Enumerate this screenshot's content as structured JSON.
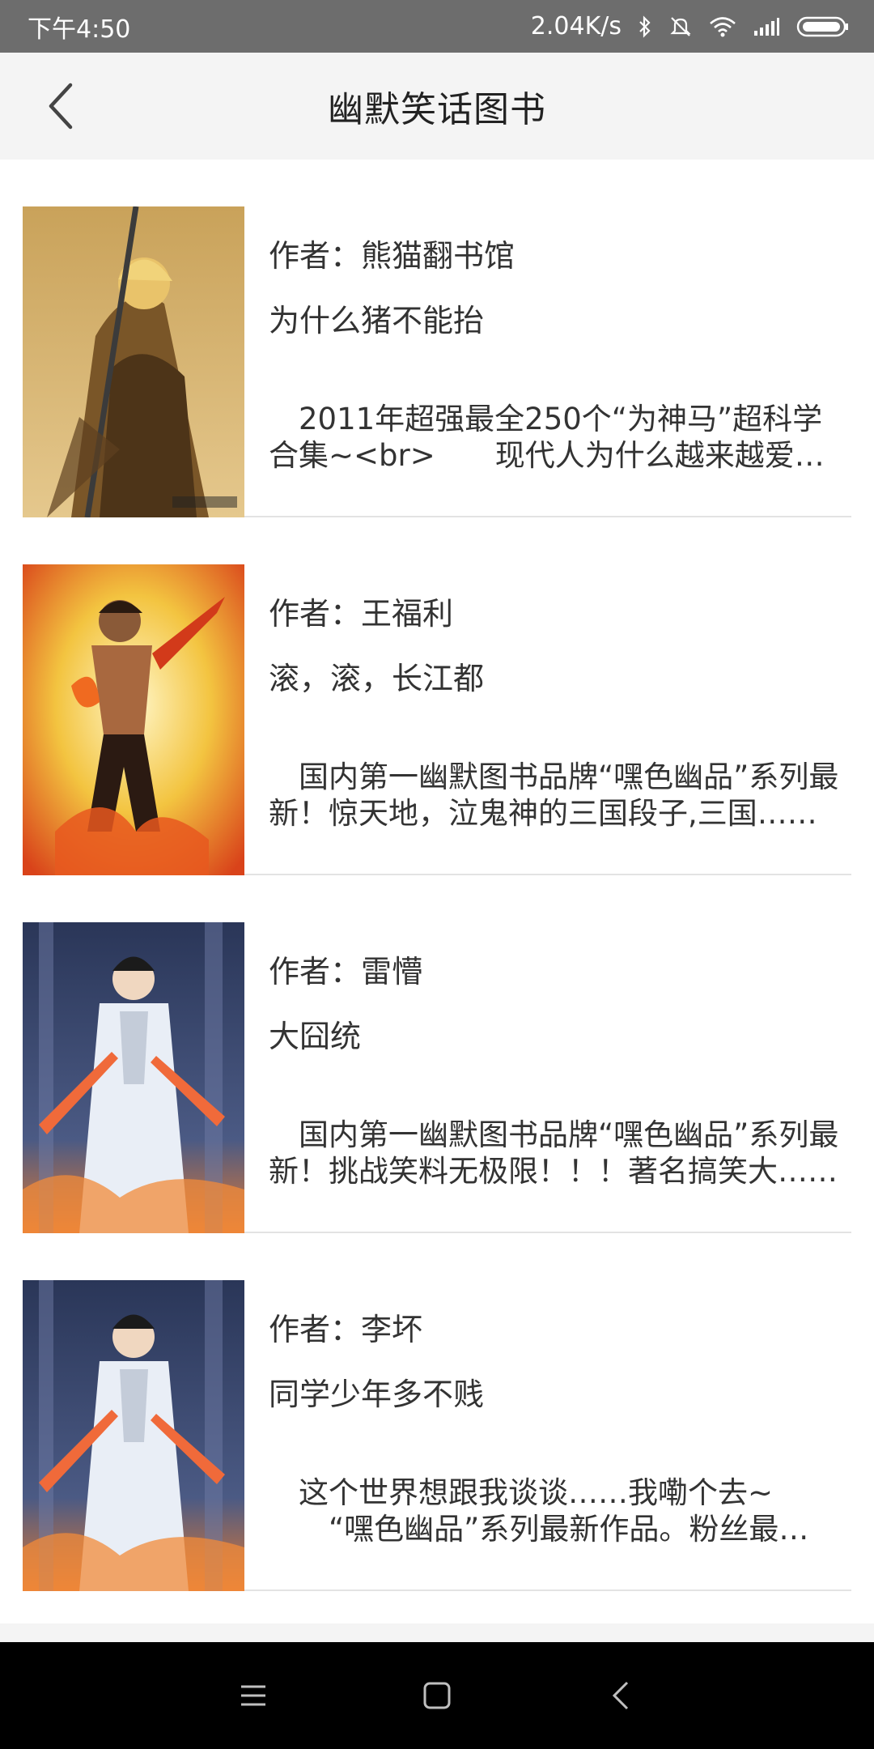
{
  "status_bar": {
    "time": "下午4:50",
    "net_speed": "2.04K/s",
    "icons": [
      "bluetooth-icon",
      "mute-icon",
      "wifi-icon",
      "signal-icon",
      "battery-icon"
    ]
  },
  "header": {
    "title": "幽默笑话图书",
    "back_icon": "chevron-left-icon"
  },
  "books": [
    {
      "author": "作者：熊猫翻书馆",
      "title": "为什么猪不能抬",
      "description": "　2011年超强最全250个“为神马”超科学合集~<br>　　现代人为什么越来越爱挖坑……",
      "cover_palette": [
        "#a07a3a",
        "#d8b36a",
        "#5b3f1c"
      ]
    },
    {
      "author": "作者：王福利",
      "title": "滚，滚，长江都",
      "description": "　国内第一幽默图书品牌“嘿色幽品”系列最新！惊天地，泣鬼神的三国段子,三国……",
      "cover_palette": [
        "#f2c23a",
        "#e0541e",
        "#fff1b0"
      ]
    },
    {
      "author": "作者：雷懵",
      "title": "大囧统",
      "description": "　国内第一幽默图书品牌“嘿色幽品”系列最新！挑战笑料无极限！！！著名搞笑大……",
      "cover_palette": [
        "#2f3f66",
        "#e9eef6",
        "#f08a3a"
      ]
    },
    {
      "author": "作者：李坏",
      "title": "同学少年多不贱",
      "description": "　这个世界想跟我谈谈……我嘞个去~\n　　“嘿色幽品”系列最新作品。粉丝最多……",
      "cover_palette": [
        "#2f3f66",
        "#e9eef6",
        "#f08a3a"
      ]
    }
  ],
  "nav": {
    "menu_icon": "menu-icon",
    "home_icon": "home-square-icon",
    "back_icon": "back-triangle-icon"
  }
}
